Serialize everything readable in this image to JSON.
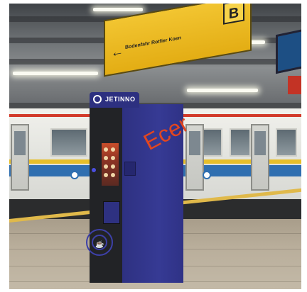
{
  "scene": {
    "sign": {
      "text": "Bodenfahr Rotfier Koen",
      "letter": "B",
      "arrow": "←"
    },
    "kiosk": {
      "brand": "JETINNO"
    },
    "watermark": "Ecer"
  }
}
